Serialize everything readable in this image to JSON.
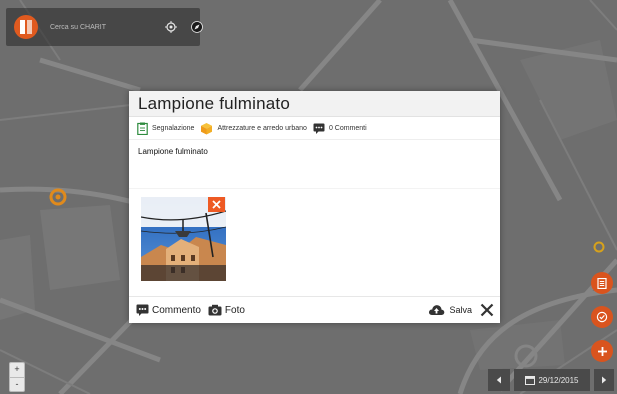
{
  "search": {
    "placeholder": "Cerca su CHARIT"
  },
  "report": {
    "title": "Lampione fulminato",
    "type_label": "Segnalazione",
    "category_label": "Attrezzature e arredo urbano",
    "comments_label": "0 Commenti",
    "description": "Lampione fulminato"
  },
  "footer": {
    "comment_label": "Commento",
    "photo_label": "Foto",
    "save_label": "Salva"
  },
  "zoom": {
    "in_label": "+",
    "out_label": "-"
  },
  "datebar": {
    "date": "29/12/2015"
  },
  "icons": {
    "logo": "charit-logo",
    "locate": "crosshair-icon",
    "compass": "compass-icon",
    "type": "clipboard-icon",
    "category": "box-icon",
    "comments": "comment-icon",
    "comment_btn": "comment-icon",
    "photo_btn": "camera-icon",
    "save": "cloud-upload-icon",
    "close": "close-icon",
    "fab1": "document-icon",
    "fab2": "check-circle-icon",
    "fab3": "plus-icon",
    "remove_photo": "close-icon"
  },
  "colors": {
    "accent": "#d9541e",
    "marker": "#e08a1c",
    "modal_bg": "#ffffff",
    "map_bg": "#6f6f6f"
  }
}
